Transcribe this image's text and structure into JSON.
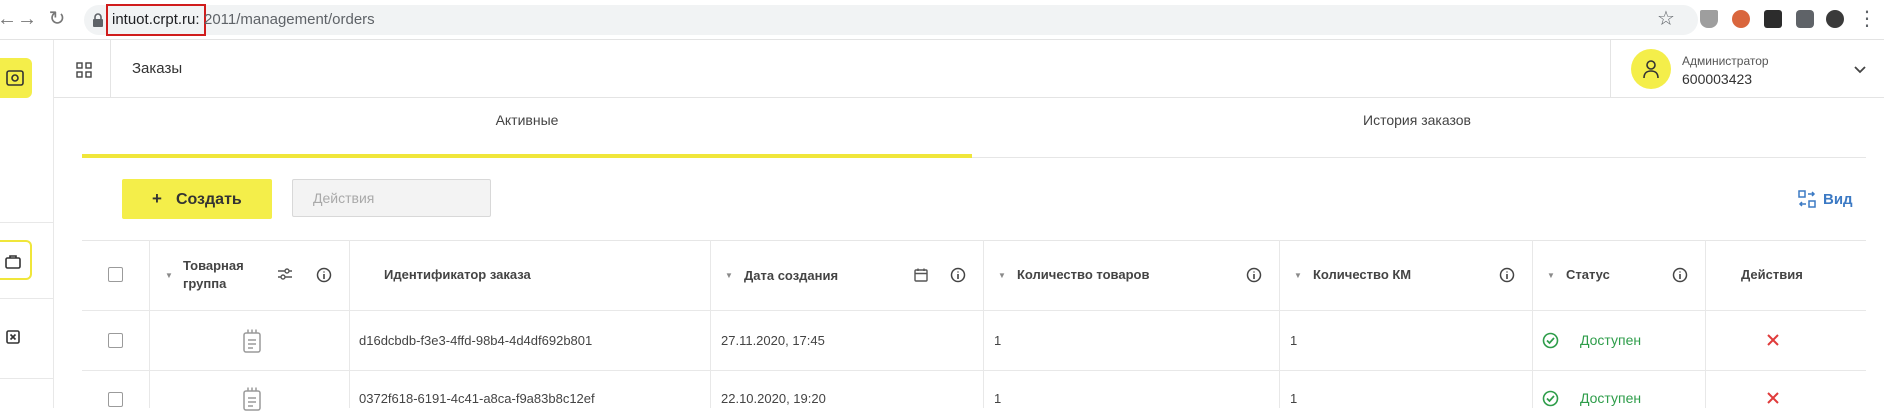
{
  "browser": {
    "url_host": "intuot.crpt.ru:",
    "url_path": "2011/management/orders",
    "icons": [
      "back-icon",
      "forward-icon",
      "reload-icon",
      "lock-icon",
      "star-icon",
      "menu-icon"
    ]
  },
  "header": {
    "page_title": "Заказы",
    "user_role": "Администратор",
    "user_id": "600003423"
  },
  "tabs": [
    {
      "label": "Активные",
      "active": true
    },
    {
      "label": "История заказов",
      "active": false
    }
  ],
  "toolbar": {
    "create_label": "Создать",
    "create_plus": "+",
    "actions_placeholder": "Действия",
    "view_label": "Вид"
  },
  "table": {
    "headers": {
      "product_group": "Товарная группа",
      "order_id": "Идентификатор заказа",
      "created": "Дата создания",
      "item_count": "Количество товаров",
      "km_count": "Количество КМ",
      "status": "Статус",
      "actions": "Действия"
    },
    "rows": [
      {
        "order_id": "d16dcbdb-f3e3-4ffd-98b4-4d4df692b801",
        "created": "27.11.2020, 17:45",
        "item_count": "1",
        "km_count": "1",
        "status": "Доступен"
      },
      {
        "order_id": "0372f618-6191-4c41-a8ca-f9a83b8c12ef",
        "created": "22.10.2020, 19:20",
        "item_count": "1",
        "km_count": "1",
        "status": "Доступен"
      }
    ]
  },
  "colors": {
    "accent_yellow": "#f4ee4a",
    "status_green": "#2e9d4a",
    "delete_red": "#e03b3b",
    "link_blue": "#3c7ac4",
    "highlight_red": "#d01c1c"
  }
}
